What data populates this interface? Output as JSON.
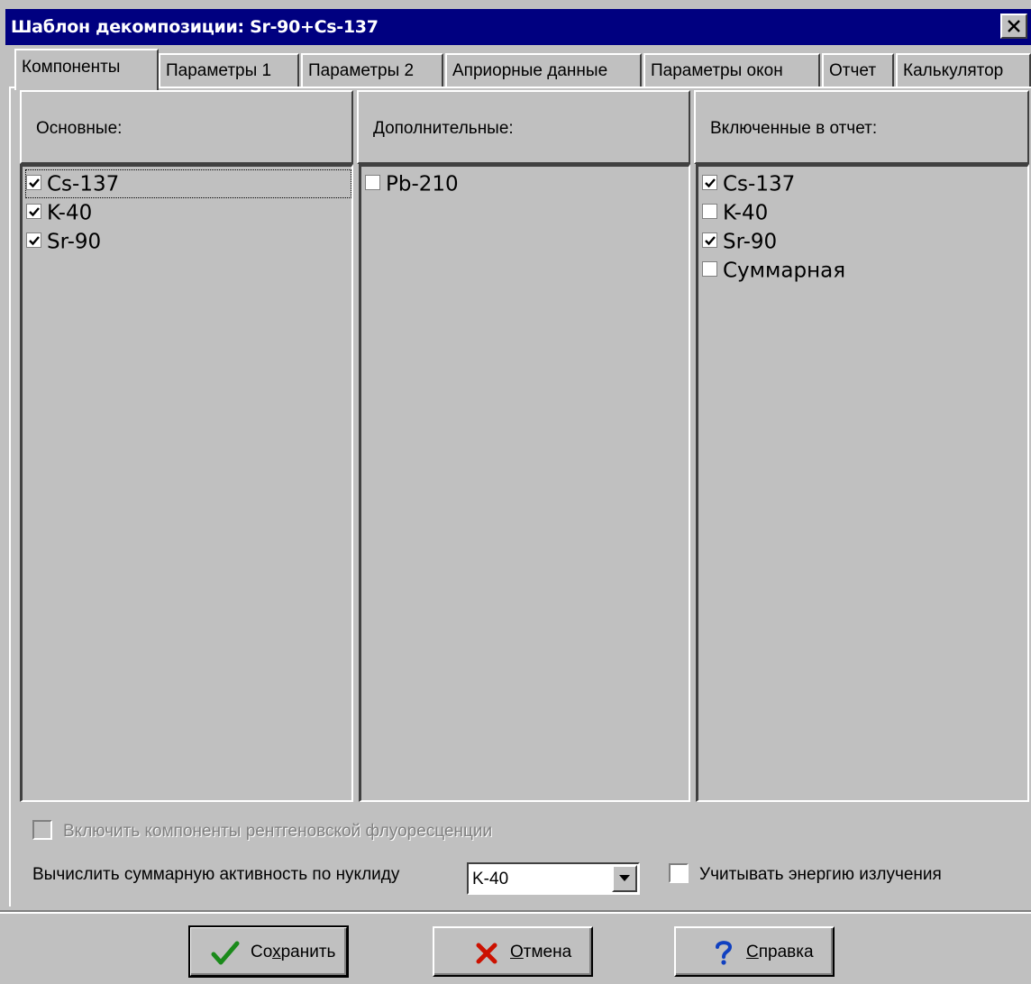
{
  "window": {
    "title": "Шаблон декомпозиции: Sr-90+Cs-137"
  },
  "tabs": [
    {
      "label": "Компоненты",
      "active": true
    },
    {
      "label": "Параметры 1",
      "active": false
    },
    {
      "label": "Параметры 2",
      "active": false
    },
    {
      "label": "Априорные данные",
      "active": false
    },
    {
      "label": "Параметры окон",
      "active": false
    },
    {
      "label": "Отчет",
      "active": false
    },
    {
      "label": "Калькулятор",
      "active": false
    }
  ],
  "columns": {
    "main": {
      "header": "Основные:",
      "items": [
        {
          "label": "Cs-137",
          "checked": true
        },
        {
          "label": "K-40",
          "checked": true
        },
        {
          "label": "Sr-90",
          "checked": true
        }
      ]
    },
    "additional": {
      "header": "Дополнительные:",
      "items": [
        {
          "label": "Pb-210",
          "checked": false
        }
      ]
    },
    "report": {
      "header": "Включенные в отчет:",
      "items": [
        {
          "label": "Cs-137",
          "checked": true
        },
        {
          "label": "K-40",
          "checked": false
        },
        {
          "label": "Sr-90",
          "checked": true
        },
        {
          "label": "Суммарная",
          "checked": false
        }
      ]
    }
  },
  "xrf": {
    "label": "Включить компоненты рентгеновской флуоресценции",
    "checked": false,
    "disabled": true
  },
  "total_activity": {
    "label": "Вычислить суммарную активность по нуклиду",
    "selected": "K-40"
  },
  "energy": {
    "label": "Учитывать энергию излучения",
    "checked": false
  },
  "buttons": {
    "save": {
      "label_underlined": "х",
      "label_pre": "Со",
      "label_post": "ранить",
      "icon": "check-icon"
    },
    "cancel": {
      "label_underlined": "О",
      "label_pre": "",
      "label_post": "тмена",
      "icon": "cross-icon"
    },
    "help": {
      "label_underlined": "С",
      "label_pre": "",
      "label_post": "правка",
      "icon": "question-icon"
    }
  },
  "colors": {
    "titlebar": "#000080",
    "face": "#c0c0c0",
    "check_green": "#1a8a1a",
    "cross_red": "#cc1100",
    "help_blue": "#1040c0"
  }
}
